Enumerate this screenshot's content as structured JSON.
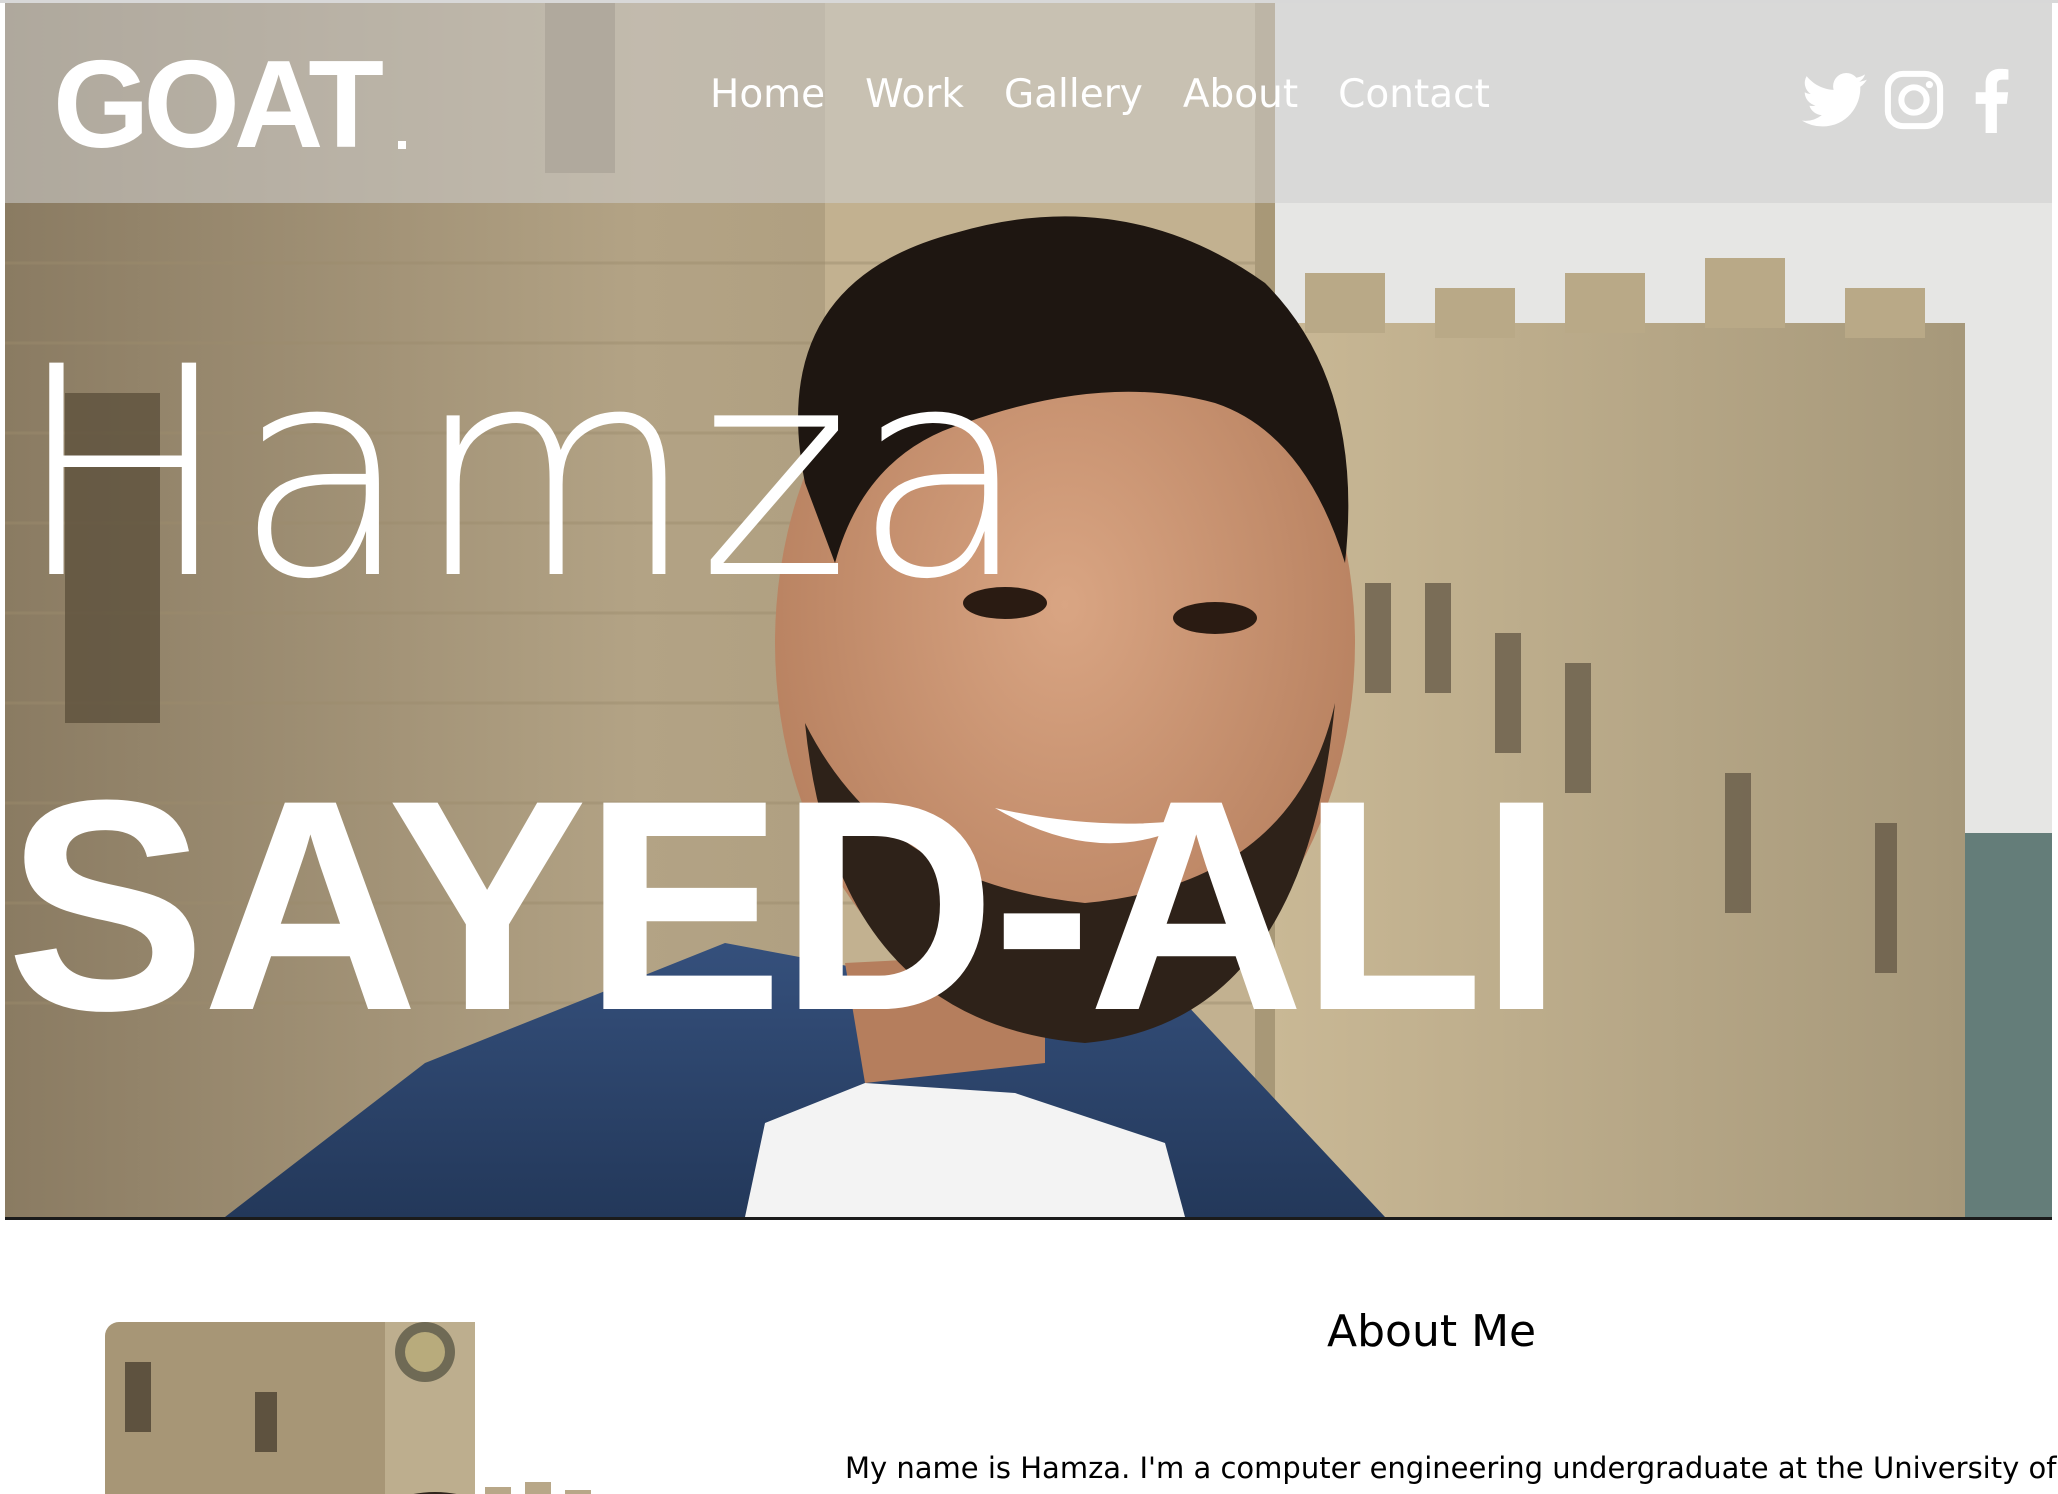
{
  "brand": {
    "logo_text": "GOAT",
    "logo_dot": "."
  },
  "nav": {
    "links": [
      {
        "label": "Home"
      },
      {
        "label": "Work"
      },
      {
        "label": "Gallery"
      },
      {
        "label": "About"
      },
      {
        "label": "Contact"
      }
    ]
  },
  "social": [
    {
      "icon": "twitter-icon"
    },
    {
      "icon": "instagram-icon"
    },
    {
      "icon": "facebook-icon"
    }
  ],
  "hero": {
    "first_name": "Hamza",
    "last_name": "SAYED-ALI"
  },
  "about": {
    "title": "About Me",
    "text": "My name is Hamza. I'm a computer engineering undergraduate at the University of"
  },
  "colors": {
    "nav_overlay": "#cdcdcd",
    "text_on_hero": "#ffffff",
    "body_text": "#000000",
    "hero_stone": "#b9aa8f"
  }
}
